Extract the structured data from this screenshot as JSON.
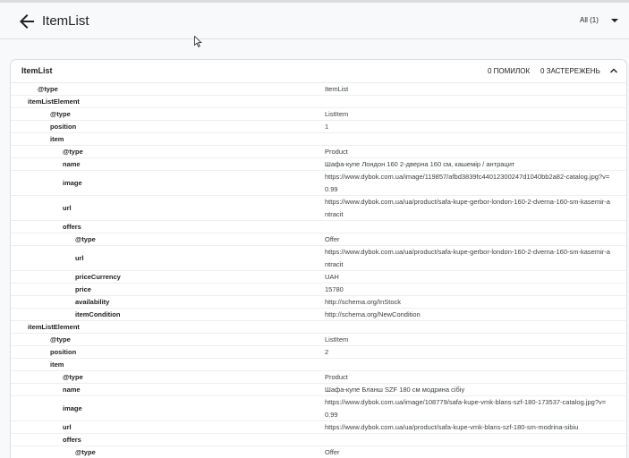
{
  "header": {
    "back_icon": "arrow-left-icon",
    "title": "ItemList",
    "filter_label": "All (1)",
    "filter_icon": "caret-down-icon"
  },
  "card": {
    "title": "ItemList",
    "errors": "0 ПОМИЛОК",
    "warnings": "0 ЗАСТЕРЕЖЕНЬ",
    "collapse_icon": "chevron-up-icon"
  },
  "rows": [
    {
      "key": "@type",
      "value": "ItemList",
      "depth": 2
    },
    {
      "key": "itemListElement",
      "value": "",
      "depth": 1
    },
    {
      "key": "@type",
      "value": "ListItem",
      "depth": 3
    },
    {
      "key": "position",
      "value": "1",
      "depth": 3
    },
    {
      "key": "item",
      "value": "",
      "depth": 3
    },
    {
      "key": "@type",
      "value": "Product",
      "depth": 4
    },
    {
      "key": "name",
      "value": "Шафа-купе Лондон 160 2-дверна 160 см, кашемір / антрацит",
      "depth": 4
    },
    {
      "key": "image",
      "value": "https://www.dybok.com.ua/image/119857/afbd3839fc44012300247d1040bb2a82-catalog.jpg?v=0.99",
      "depth": 4
    },
    {
      "key": "url",
      "value": "https://www.dybok.com.ua/ua/product/safa-kupe-gerbor-london-160-2-dverna-160-sm-kasemir-antracit",
      "depth": 4
    },
    {
      "key": "offers",
      "value": "",
      "depth": 4
    },
    {
      "key": "@type",
      "value": "Offer",
      "depth": 5
    },
    {
      "key": "url",
      "value": "https://www.dybok.com.ua/ua/product/safa-kupe-gerbor-london-160-2-dverna-160-sm-kasemir-antracit",
      "depth": 5
    },
    {
      "key": "priceCurrency",
      "value": "UAH",
      "depth": 5
    },
    {
      "key": "price",
      "value": "15780",
      "depth": 5
    },
    {
      "key": "availability",
      "value": "http://schema.org/InStock",
      "depth": 5
    },
    {
      "key": "itemCondition",
      "value": "http://schema.org/NewCondition",
      "depth": 5
    },
    {
      "key": "itemListElement",
      "value": "",
      "depth": 1
    },
    {
      "key": "@type",
      "value": "ListItem",
      "depth": 3
    },
    {
      "key": "position",
      "value": "2",
      "depth": 3
    },
    {
      "key": "item",
      "value": "",
      "depth": 3
    },
    {
      "key": "@type",
      "value": "Product",
      "depth": 4
    },
    {
      "key": "name",
      "value": "Шафа-купе Бланш SZF 180 см модрина сібіу",
      "depth": 4
    },
    {
      "key": "image",
      "value": "https://www.dybok.com.ua/image/108779/safa-kupe-vmk-blans-szf-180-173537-catalog.jpg?v=0.99",
      "depth": 4
    },
    {
      "key": "url",
      "value": "https://www.dybok.com.ua/ua/product/safa-kupe-vmk-blans-szf-180-sm-modrina-sibiu",
      "depth": 4
    },
    {
      "key": "offers",
      "value": "",
      "depth": 4
    },
    {
      "key": "@type",
      "value": "Offer",
      "depth": 5
    }
  ]
}
